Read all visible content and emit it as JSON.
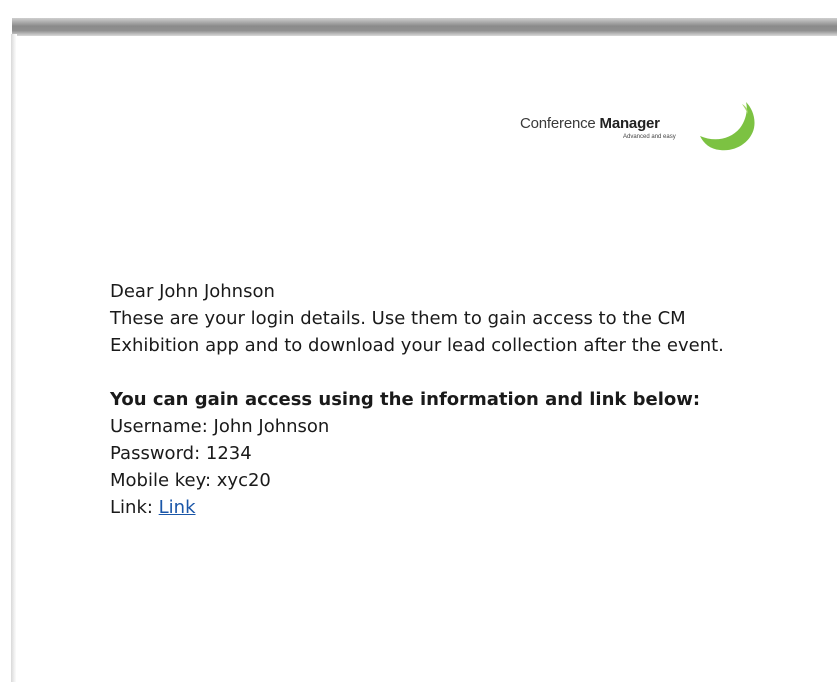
{
  "logo": {
    "name_first": "Conference",
    "name_second": "Manager",
    "tagline": "Advanced and easy",
    "accent_color": "#7cc242"
  },
  "letter": {
    "greeting": "Dear John Johnson",
    "intro": "These are your login details. Use them to gain access to the CM Exhibition app and to download your lead collection after the event.",
    "access_heading": "You can gain access using the information and link below:",
    "username_label": "Username: ",
    "username_value": "John Johnson",
    "password_label": "Password: ",
    "password_value": "1234",
    "mobile_key_label": "Mobile key: ",
    "mobile_key_value": "xyc20",
    "link_label": "Link: ",
    "link_text": "Link"
  }
}
